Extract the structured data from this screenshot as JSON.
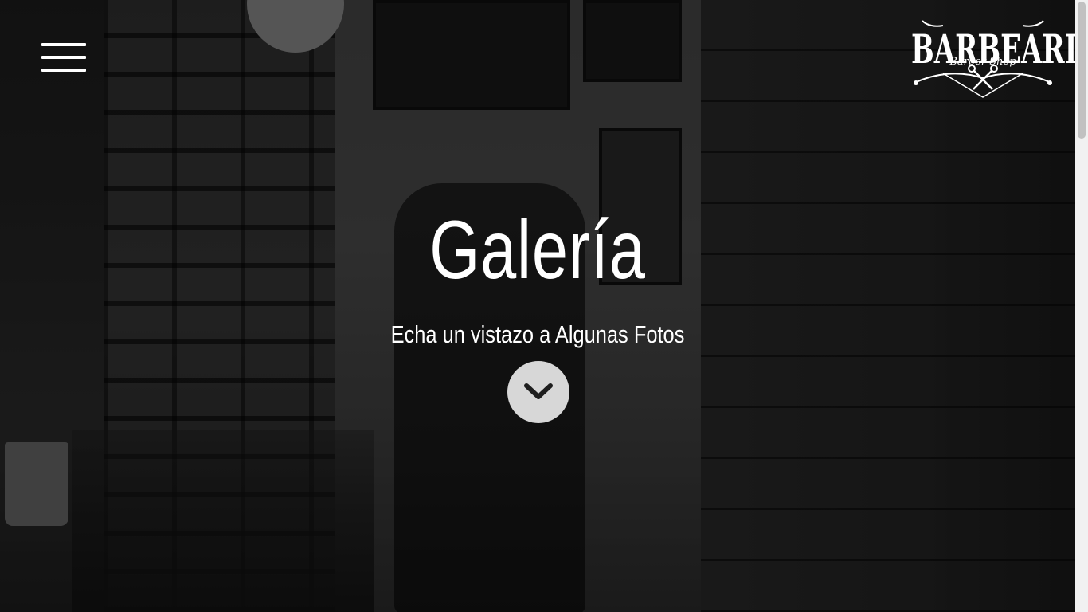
{
  "header": {
    "menu_icon": "hamburger-menu-icon",
    "logo": {
      "title": "BARBEARIA",
      "subtitle": "Barber Shop",
      "icon": "scissors-mustache-icon"
    }
  },
  "hero": {
    "title": "Galería",
    "subtitle": "Echa un vistazo a Algunas Fotos",
    "scroll_icon": "chevron-down-icon"
  },
  "colors": {
    "text": "#ffffff",
    "button_bg": "#d7d7d7",
    "chevron": "#1e1e1e",
    "decor_circle": "#555555"
  }
}
